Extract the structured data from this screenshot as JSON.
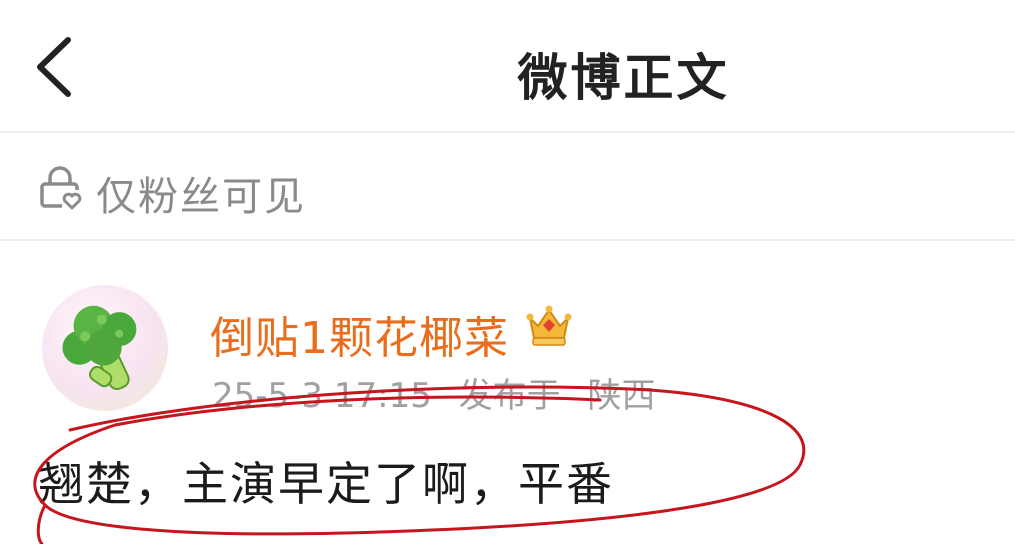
{
  "header": {
    "title": "微博正文",
    "back_icon": "chevron-left-icon"
  },
  "visibility": {
    "icon": "lock-heart-icon",
    "label": "仅粉丝可见"
  },
  "post": {
    "author": {
      "avatar_icon": "broccoli-avatar",
      "name": "倒贴1颗花椰菜",
      "badge_icon": "vip-crown-icon",
      "name_color": "#ea6d1c"
    },
    "timestamp": "25-5-3 17:15",
    "published_label": "发布于",
    "location": "陕西",
    "text": "翘楚，主演早定了啊，平番"
  },
  "annotation": {
    "shape": "hand-drawn-ellipse",
    "color": "#c4161c"
  }
}
